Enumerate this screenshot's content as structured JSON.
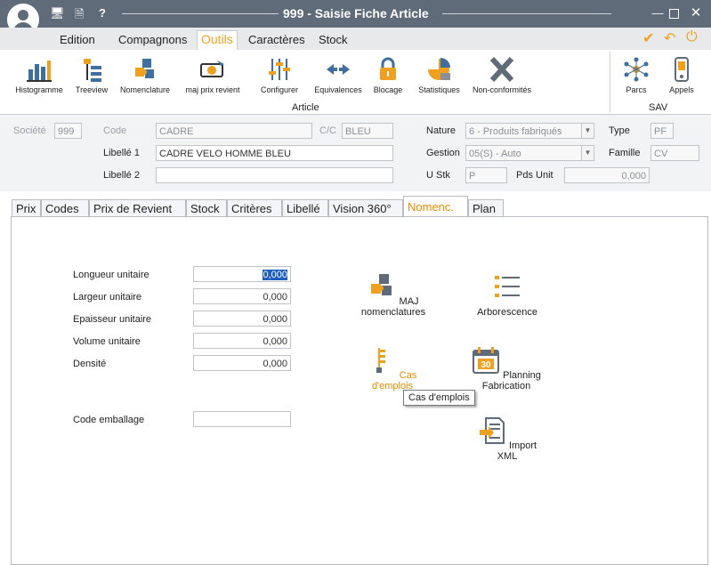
{
  "window": {
    "title": "999 - Saisie Fiche Article",
    "controls": [
      "minimize-icon",
      "maximize-icon",
      "close-icon"
    ]
  },
  "menu": {
    "items": [
      {
        "label": "Edition"
      },
      {
        "label": "Compagnons"
      },
      {
        "label": "Outils",
        "active": true
      },
      {
        "label": "Caractères"
      },
      {
        "label": "Stock"
      }
    ]
  },
  "ribbon": {
    "article_group_label": "Article",
    "sav_group_label": "SAV",
    "buttons": [
      {
        "label": "Histogramme",
        "icon": "histogram-icon"
      },
      {
        "label": "Treeview",
        "icon": "treeview-icon"
      },
      {
        "label": "Nomenclature",
        "icon": "puzzle-icon"
      },
      {
        "label": "maj prix revient",
        "icon": "money-icon"
      },
      {
        "label": "Configurer",
        "icon": "sliders-icon"
      },
      {
        "label": "Equivalences",
        "icon": "arrows-icon"
      },
      {
        "label": "Blocage",
        "icon": "lock-icon"
      },
      {
        "label": "Statistiques",
        "icon": "pie-chart-icon"
      },
      {
        "label": "Non-conformités",
        "icon": "x-icon"
      }
    ],
    "sav_buttons": [
      {
        "label": "Parcs",
        "icon": "network-icon"
      },
      {
        "label": "Appels",
        "icon": "phone-icon"
      }
    ]
  },
  "header": {
    "societe_label": "Société",
    "societe_value": "999",
    "code_label": "Code",
    "code_value": "CADRE",
    "cc_label": "C/C",
    "cc_value": "BLEU",
    "libelle1_label": "Libellé 1",
    "libelle1_value": "CADRE VELO HOMME BLEU",
    "libelle2_label": "Libellé 2",
    "libelle2_value": "",
    "nature_label": "Nature",
    "nature_value": "6 - Produits fabriqués",
    "gestion_label": "Gestion",
    "gestion_value": "05(S) - Auto",
    "ustk_label": "U Stk",
    "ustk_value": "P",
    "pdsunit_label": "Pds Unit",
    "pdsunit_value": "0,000",
    "type_label": "Type",
    "type_value": "PF",
    "famille_label": "Famille",
    "famille_value": "CV"
  },
  "tabs": [
    {
      "label": "Prix"
    },
    {
      "label": "Codes"
    },
    {
      "label": "Prix de Revient"
    },
    {
      "label": "Stock"
    },
    {
      "label": "Critères"
    },
    {
      "label": "Libellé"
    },
    {
      "label": "Vision 360°"
    },
    {
      "label": "Nomenc.",
      "active": true
    },
    {
      "label": "Plan"
    }
  ],
  "nomenc": {
    "fields": [
      {
        "label": "Longueur unitaire",
        "value": "0,000",
        "selected": true
      },
      {
        "label": "Largeur unitaire",
        "value": "0,000"
      },
      {
        "label": "Epaisseur unitaire",
        "value": "0,000"
      },
      {
        "label": "Volume unitaire",
        "value": "0,000"
      },
      {
        "label": "Densité",
        "value": "0,000"
      }
    ],
    "code_emballage_label": "Code emballage",
    "code_emballage_value": "",
    "actions": [
      {
        "label": "MAJ nomenclatures",
        "icon": "puzzle-icon"
      },
      {
        "label": "Arborescence",
        "icon": "list-icon"
      },
      {
        "label": "Cas d'emplois",
        "icon": "tree-icon"
      },
      {
        "label": "Planning Fabrication",
        "icon": "calendar-icon"
      },
      {
        "label": "Import XML",
        "icon": "import-xml-icon"
      }
    ],
    "tooltip": "Cas d'emplois"
  },
  "colors": {
    "titlebar": "#5f6b78",
    "accent_orange": "#f0a020",
    "icon_blue": "#3f6f9f"
  }
}
